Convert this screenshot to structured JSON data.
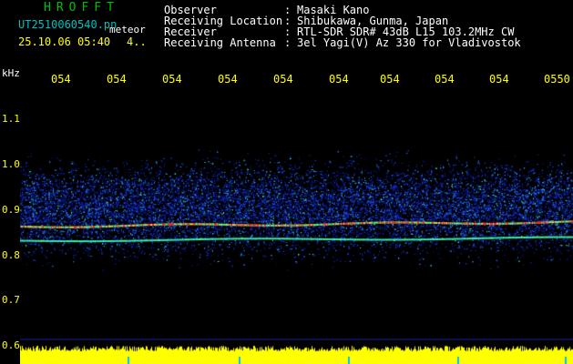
{
  "header": {
    "app_name": "HROFFT",
    "filename": "UT2510060540.pn",
    "overlay_label": "meteor",
    "datetime": "25.10.06 05:40",
    "count": "4.."
  },
  "metadata": [
    {
      "key": "Observer",
      "value": "Masaki Kano"
    },
    {
      "key": "Receiving Location",
      "value": "Shibukawa, Gunma, Japan"
    },
    {
      "key": "Receiver",
      "value": "RTL-SDR SDR# 43dB L15 103.2MHz CW"
    },
    {
      "key": "Receiving Antenna",
      "value": "3el Yagi(V) Az 330 for Vladivostok"
    }
  ],
  "separator": ":",
  "colors": {
    "header_text": "#ffffff",
    "app_name": "#00c000",
    "filename": "#00c0c0",
    "meteor": "#ffffff",
    "datetime": "#ffff00",
    "axis_text": "#ffff00",
    "unit_text": "#ffffff",
    "signal_red": "#ff2020",
    "signal_green": "#40ff80",
    "noise_blue": "#1830ff",
    "level_bar": "#ffff00",
    "level_marker": "#00c0ff"
  },
  "chart_data": {
    "type": "heatmap",
    "title": "",
    "xlabel": "",
    "ylabel": "kHz",
    "x_ticks": [
      "054",
      "054",
      "054",
      "054",
      "054",
      "054",
      "054",
      "054",
      "054",
      "0550"
    ],
    "y_ticks": [
      "1.1",
      "1.0",
      "0.9",
      "0.8",
      "0.7",
      "0.6"
    ],
    "ylim": [
      0.6,
      1.15
    ],
    "noise_band_khz": [
      0.78,
      1.02
    ],
    "carrier_lines_khz": [
      0.864,
      0.833
    ],
    "level_bar": "yellow signal-level strip along bottom"
  }
}
